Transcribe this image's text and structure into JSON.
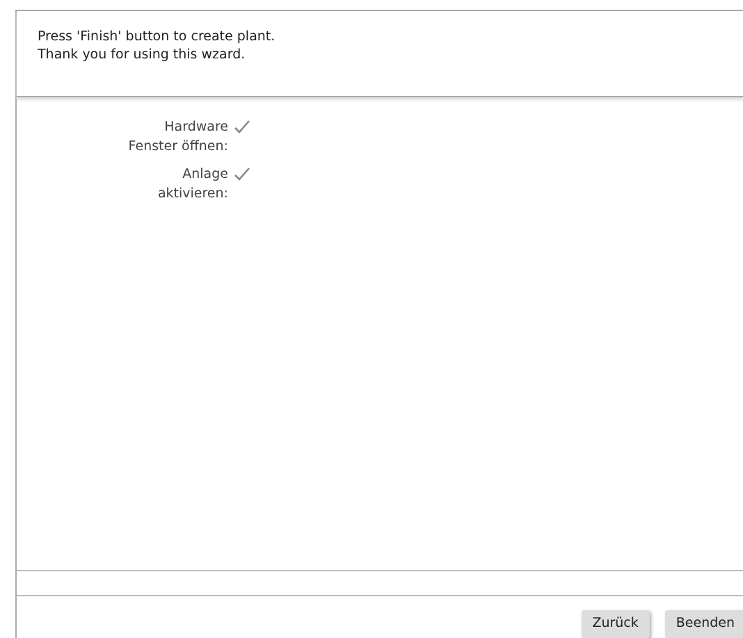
{
  "header": {
    "lines": [
      "Press 'Finish' button to create plant.",
      "Thank you for using this wzard."
    ]
  },
  "summary": [
    {
      "label": "Hardware Fenster öffnen:",
      "checked": true
    },
    {
      "label": "Anlage aktivieren:",
      "checked": true
    }
  ],
  "buttons": [
    "Zurück",
    "Beenden"
  ]
}
